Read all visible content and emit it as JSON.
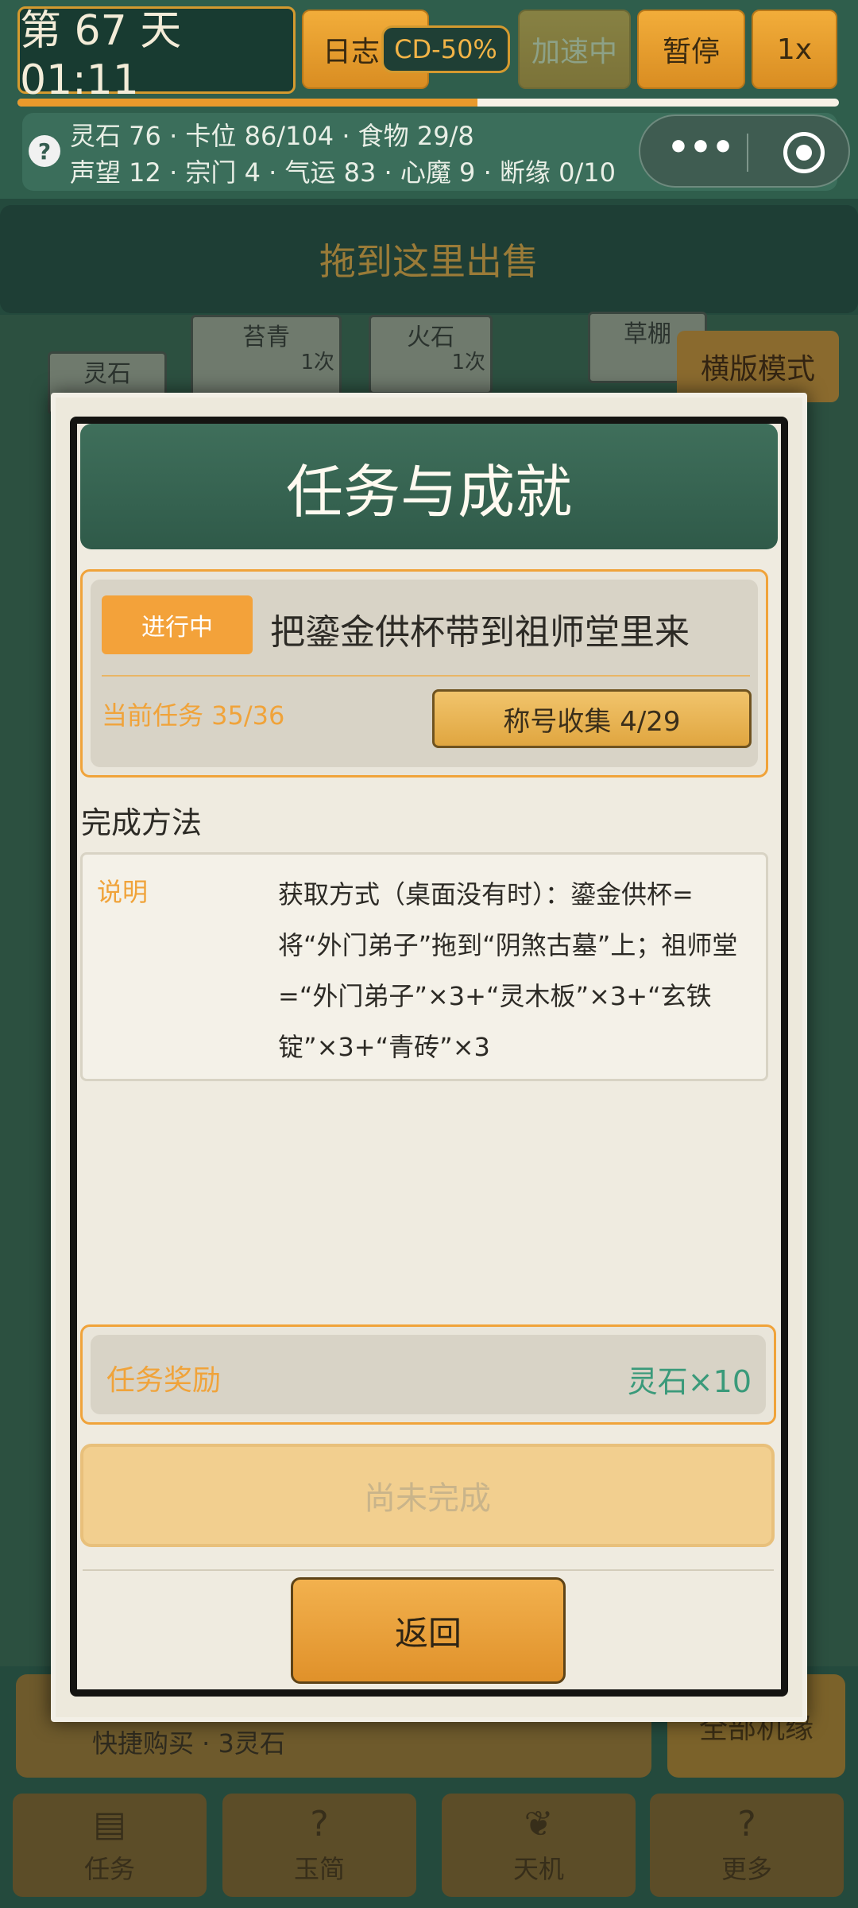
{
  "topbar": {
    "day_display": "第 67 天 01:11",
    "log_label": "日志",
    "cd_badge": "CD-50%",
    "speed_label": "加速中",
    "pause_label": "暂停",
    "rate_label": "1x",
    "day_progress": 0.56
  },
  "stats": {
    "line1": "灵石 76 · 卡位 86/104 · 食物 29/8",
    "line2": "声望 12 · 宗门 4 · 气运 83 · 心魔 9 · 断缘 0/10",
    "help_icon": "?",
    "menu_dots": "•••"
  },
  "board": {
    "sell_label": "拖到这里出售",
    "cards": [
      {
        "name": "苔青",
        "tag": "1次"
      },
      {
        "name": "火石",
        "tag": "1次"
      },
      {
        "name": "灵石",
        "tag": ""
      },
      {
        "name": "草棚",
        "tag": ""
      }
    ],
    "landscape_label": "横版模式",
    "quickbuy_label": "快捷购买 · 3灵石",
    "all_fate_label": "全部机缘",
    "tabs": [
      {
        "label": "任务",
        "icon": "scroll-icon"
      },
      {
        "label": "玉简",
        "icon": "question-icon"
      },
      {
        "label": "天机",
        "icon": "leaf-icon"
      },
      {
        "label": "更多",
        "icon": "more-icon"
      }
    ]
  },
  "modal": {
    "title": "任务与成就",
    "status": "进行中",
    "task_title": "把鎏金供杯带到祖师堂里来",
    "current_task": "当前任务  35/36",
    "collect_label": "称号收集  4/29",
    "method_heading": "完成方法",
    "method_label": "说明",
    "method_text": "获取方式（桌面没有时）：鎏金供杯=将“外门弟子”拖到“阴煞古墓”上；祖师堂=“外门弟子”×3+“灵木板”×3+“玄铁锭”×3+“青砖”×3",
    "reward_label": "任务奖励",
    "reward_value": "灵石×10",
    "not_done_label": "尚未完成",
    "back_label": "返回"
  },
  "colors": {
    "accent_orange": "#f0a33a",
    "header_green": "#3f6f5b",
    "reward_green": "#3a9a7a"
  }
}
